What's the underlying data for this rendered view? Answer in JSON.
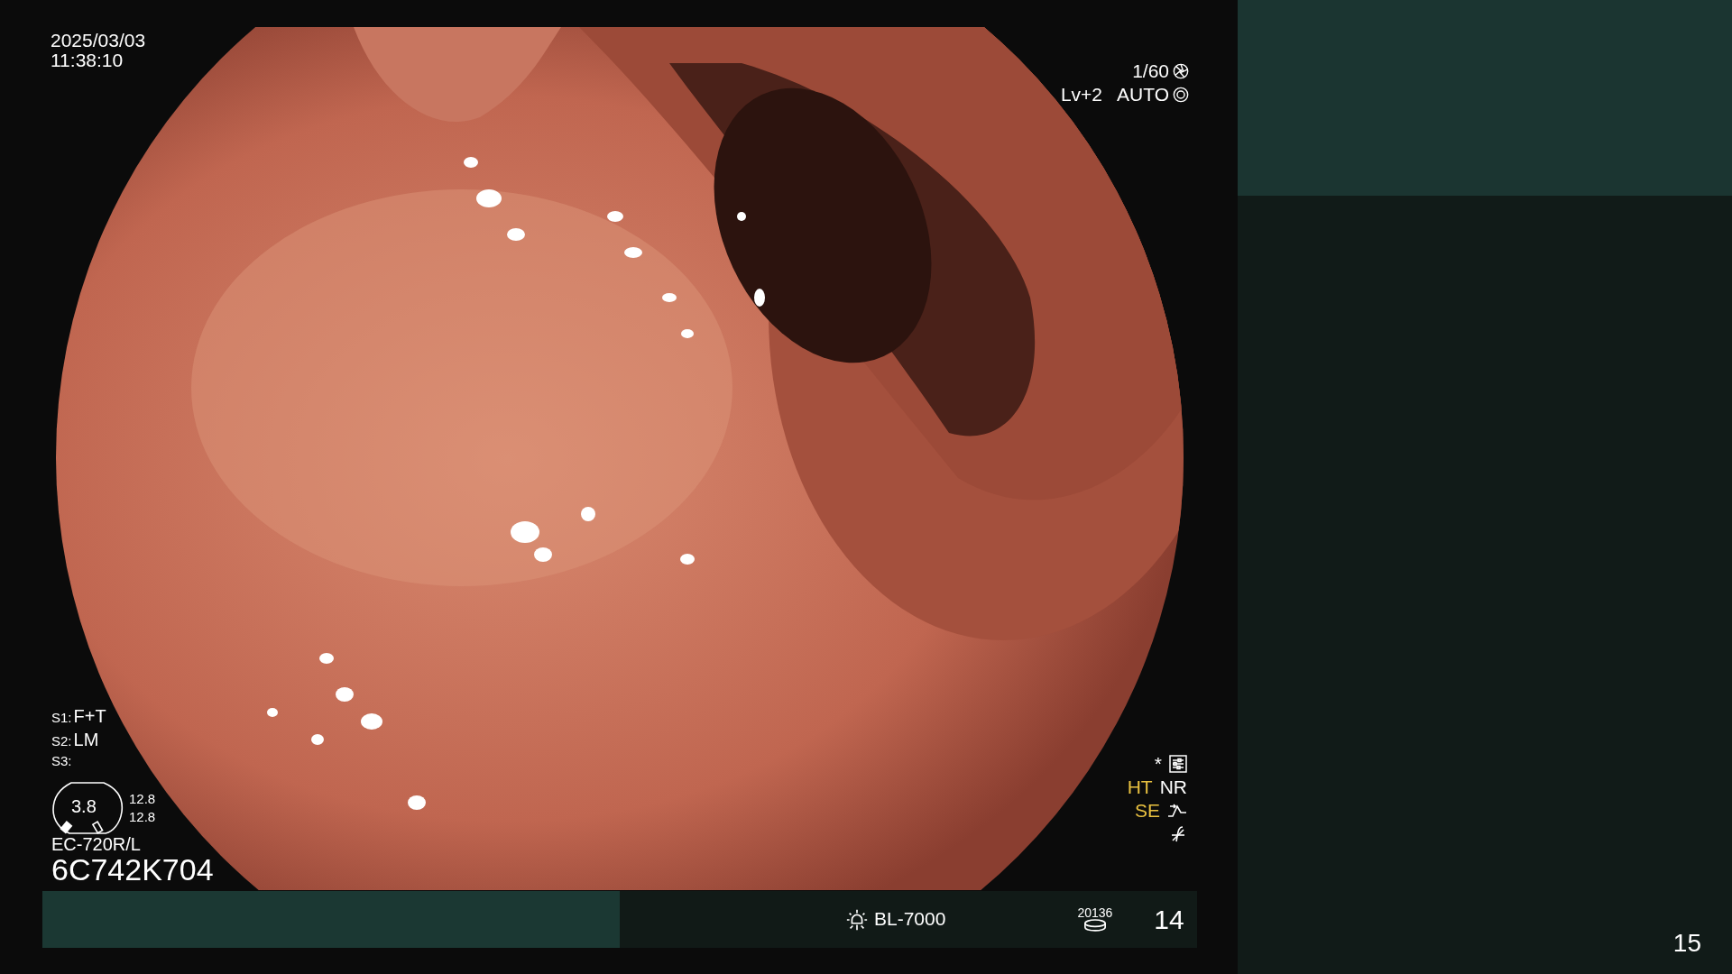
{
  "overlay_top_left": {
    "date": "2025/03/03",
    "time": "11:38:10"
  },
  "overlay_top_right": {
    "shutter": "1/60",
    "exposure_level": "Lv+2",
    "iris_mode": "AUTO"
  },
  "scope_settings": [
    {
      "label": "S1:",
      "value": "F+T"
    },
    {
      "label": "S2:",
      "value": "LM"
    },
    {
      "label": "S3:"
    }
  ],
  "scope_gauge": {
    "value": "3.8",
    "readings": [
      "12.8",
      "12.8"
    ]
  },
  "scope_model": "EC-720R/L",
  "scope_serial": "6C742K704",
  "image_modes": [
    {
      "label": "HT",
      "color": "#e8c040"
    },
    {
      "label": "NR",
      "color": "#ffffff"
    },
    {
      "label": "SE",
      "color": "#e8c040"
    }
  ],
  "asterisk": "*",
  "bottom_bar": {
    "light_source": "BL-7000",
    "storage_count": "20136",
    "image_count": "14"
  },
  "page_number": "15"
}
